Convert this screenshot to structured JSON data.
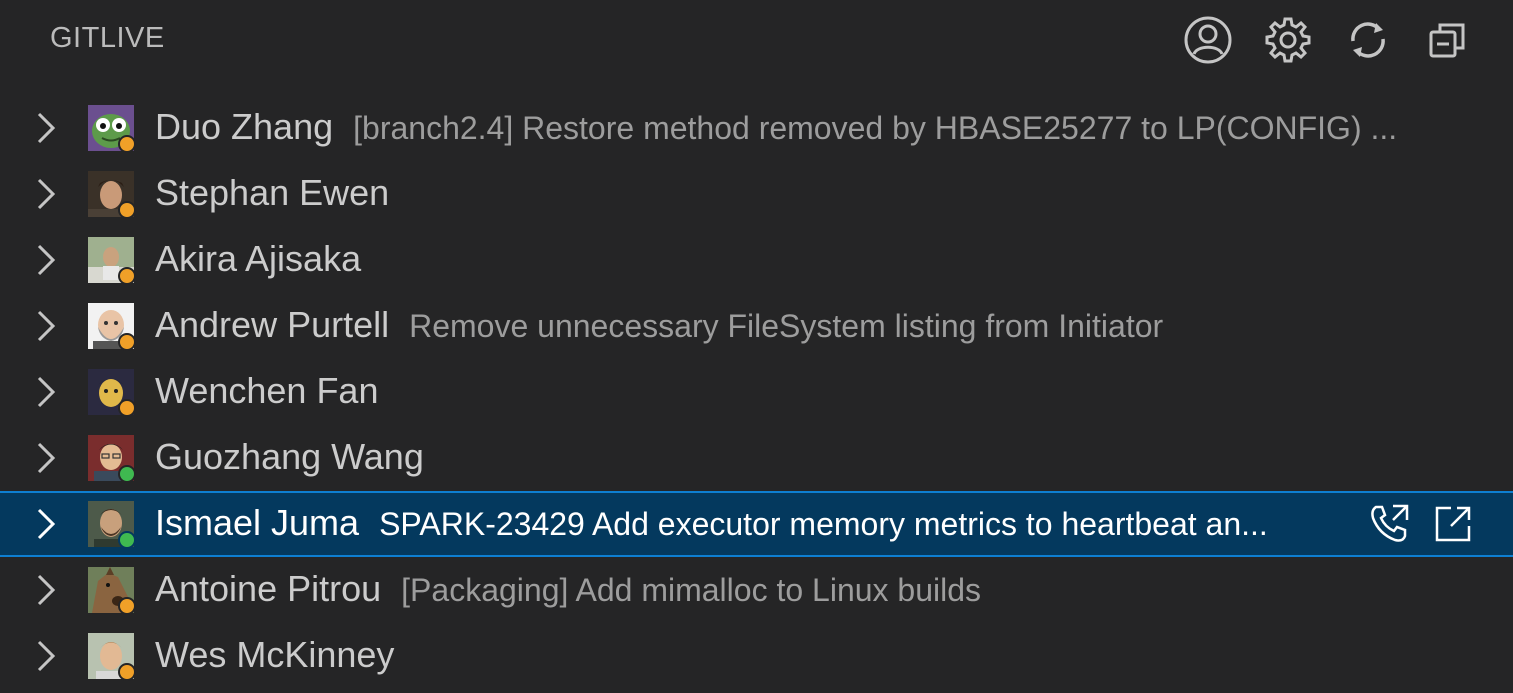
{
  "header": {
    "title": "GITLIVE",
    "actions": [
      "account-icon",
      "settings-gear-icon",
      "refresh-icon",
      "collapse-all-icon"
    ]
  },
  "colors": {
    "online": "#3fb950",
    "away": "#f0a028",
    "selection_bg": "#04395e",
    "selection_border": "#0e7fd1"
  },
  "users": [
    {
      "name": "Duo Zhang",
      "message": "[branch2.4] Restore method removed by HBASE25277 to LP(CONFIG) ...",
      "status": "away"
    },
    {
      "name": "Stephan Ewen",
      "message": "",
      "status": "away"
    },
    {
      "name": "Akira Ajisaka",
      "message": "",
      "status": "away"
    },
    {
      "name": "Andrew Purtell",
      "message": "Remove unnecessary FileSystem listing from Initiator",
      "status": "away"
    },
    {
      "name": "Wenchen Fan",
      "message": "",
      "status": "away"
    },
    {
      "name": "Guozhang Wang",
      "message": "",
      "status": "online"
    },
    {
      "name": "Ismael Juma",
      "message": "SPARK-23429 Add executor memory metrics to heartbeat an...",
      "status": "online",
      "selected": true
    },
    {
      "name": "Antoine Pitrou",
      "message": "[Packaging] Add mimalloc to Linux builds",
      "status": "away"
    },
    {
      "name": "Wes McKinney",
      "message": "",
      "status": "away"
    }
  ],
  "selected_row_actions": [
    "call-icon",
    "open-external-icon"
  ]
}
